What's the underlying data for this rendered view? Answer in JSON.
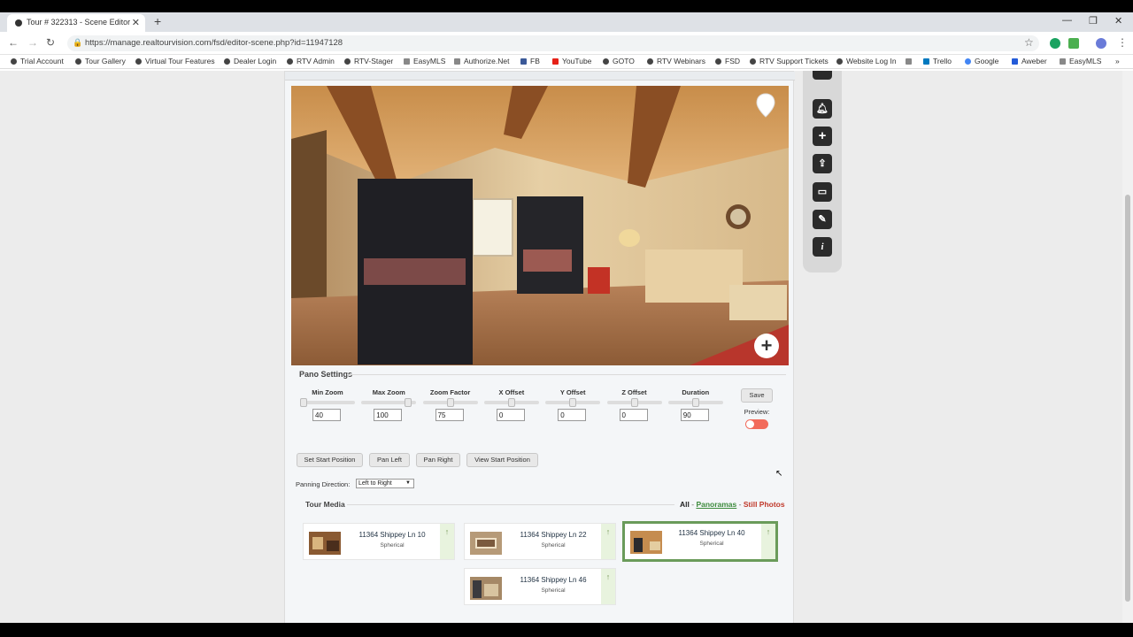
{
  "browser": {
    "tab_title": "Tour # 322313 - Scene Editor",
    "url": "https://manage.realtourvision.com/fsd/editor-scene.php?id=11947128",
    "bookmarks": [
      "Trial Account",
      "Tour Gallery",
      "Virtual Tour Features",
      "Dealer Login",
      "RTV Admin",
      "RTV-Stager",
      "EasyMLS",
      "Authorize.Net",
      "FB",
      "YouTube",
      "GOTO",
      "RTV Webinars",
      "FSD",
      "RTV Support Tickets",
      "Website Log In",
      "Trello",
      "Google",
      "Aweber",
      "EasyMLS"
    ]
  },
  "pano_settings": {
    "title": "Pano Settings",
    "sliders": [
      {
        "label": "Min Zoom",
        "value": "40",
        "level": 0.0
      },
      {
        "label": "Max Zoom",
        "value": "100",
        "level": 0.9
      },
      {
        "label": "Zoom Factor",
        "value": "75",
        "level": 0.5
      },
      {
        "label": "X Offset",
        "value": "0",
        "level": 0.5
      },
      {
        "label": "Y Offset",
        "value": "0",
        "level": 0.5
      },
      {
        "label": "Z Offset",
        "value": "0",
        "level": 0.5
      },
      {
        "label": "Duration",
        "value": "90",
        "level": 0.5
      }
    ],
    "save_label": "Save",
    "preview_label": "Preview:",
    "buttons": [
      "Set Start Position",
      "Pan Left",
      "Pan Right",
      "View Start Position"
    ],
    "panning_label": "Panning Direction:",
    "panning_value": "Left to Right"
  },
  "tour_media": {
    "title": "Tour Media",
    "filter_all": "All",
    "filter_sep1": " - ",
    "filter_panoramas": "Panoramas",
    "filter_sep2": " - ",
    "filter_still": "Still Photos",
    "items": [
      {
        "name": "11364 Shippey Ln 10",
        "type": "Spherical"
      },
      {
        "name": "11364 Shippey Ln 22",
        "type": "Spherical"
      },
      {
        "name": "11364 Shippey Ln 40",
        "type": "Spherical"
      },
      {
        "name": "11364 Shippey Ln 46",
        "type": "Spherical"
      }
    ]
  },
  "colors": {
    "accent_green": "#6a9b5a",
    "toggle_red": "#f26b5b",
    "still_photos_red": "#c0392b"
  }
}
